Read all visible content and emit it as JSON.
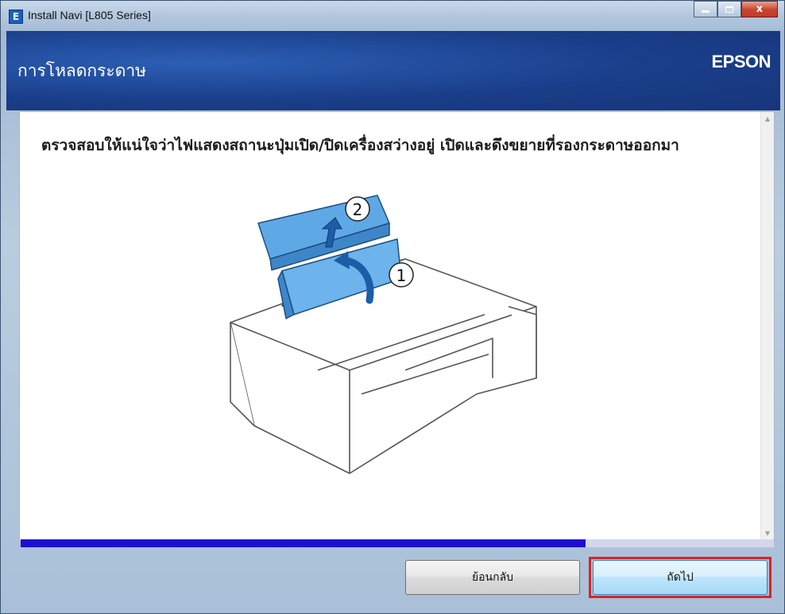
{
  "window": {
    "app_icon": "E",
    "title": "Install Navi [L805 Series]",
    "controls": {
      "minimize_icon": "minimize-icon",
      "maximize_icon": "maximize-icon",
      "close_glyph": "x"
    }
  },
  "header": {
    "title": "การโหลดกระดาษ",
    "brand": "EPSON",
    "background_color": "#1a3e8a"
  },
  "content": {
    "instruction": "ตรวจสอบให้แน่ใจว่าไฟแสดงสถานะปุ่มเปิด/ปิดเครื่องสว่างอยู่ เปิดและดึงขยายที่รองกระดาษออกมา",
    "illustration": {
      "step_1": "1",
      "step_2": "2"
    }
  },
  "progress": {
    "value_fraction": 0.75,
    "color": "#1e0fcf"
  },
  "buttons": {
    "back_label": "ย้อนกลับ",
    "next_label": "ถัดไป"
  },
  "highlight_color": "#d8232a"
}
